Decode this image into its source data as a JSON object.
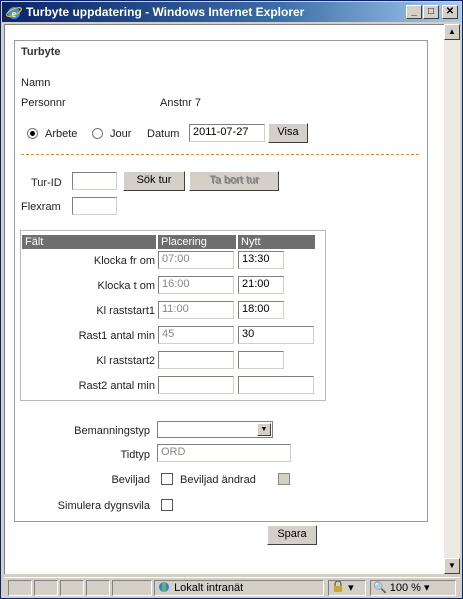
{
  "window": {
    "title": "Turbyte uppdatering - Windows Internet Explorer",
    "min_glyph": "_",
    "max_glyph": "□",
    "close_glyph": "✕"
  },
  "form": {
    "title": "Turbyte",
    "namn_label": "Namn",
    "personnr_label": "Personnr",
    "anstnr": "Anstnr 7",
    "radio_arbete": "Arbete",
    "radio_jour": "Jour",
    "datum_label": "Datum",
    "datum_value": "2011-07-27",
    "visa_button": "Visa",
    "turid_label": "Tur-ID",
    "turid_value": "",
    "sok_button": "Sök tur",
    "tabort_button": "Ta bort tur",
    "flexram_label": "Flexram",
    "flexram_value": ""
  },
  "grid": {
    "headers": [
      "Fält",
      "Placering",
      "Nytt"
    ],
    "rows": [
      {
        "label": "Klocka fr om",
        "placering": "07:00",
        "nytt": "13:30"
      },
      {
        "label": "Klocka t om",
        "placering": "16:00",
        "nytt": "21:00"
      },
      {
        "label": "Kl raststart1",
        "placering": "11:00",
        "nytt": "18:00"
      },
      {
        "label": "Rast1 antal min",
        "placering": "45",
        "nytt": "30"
      },
      {
        "label": "Kl raststart2",
        "placering": "",
        "nytt": ""
      },
      {
        "label": "Rast2 antal min",
        "placering": "",
        "nytt": ""
      }
    ]
  },
  "extra": {
    "bemanningstyp_label": "Bemanningstyp",
    "bemanningstyp_value": "",
    "tidtyp_label": "Tidtyp",
    "tidtyp_value": "ORD",
    "beviljad_label": "Beviljad",
    "beviljad_andrad_label": "Beviljad ändrad",
    "simulera_label": "Simulera dygnsvila",
    "spara_button": "Spara"
  },
  "statusbar": {
    "zone": "Lokalt intranät",
    "zoom": "100 %"
  },
  "colors": {
    "titlebar": "#0a246a",
    "divider": "#e08a3c",
    "grid_header": "#6e6e6e"
  }
}
